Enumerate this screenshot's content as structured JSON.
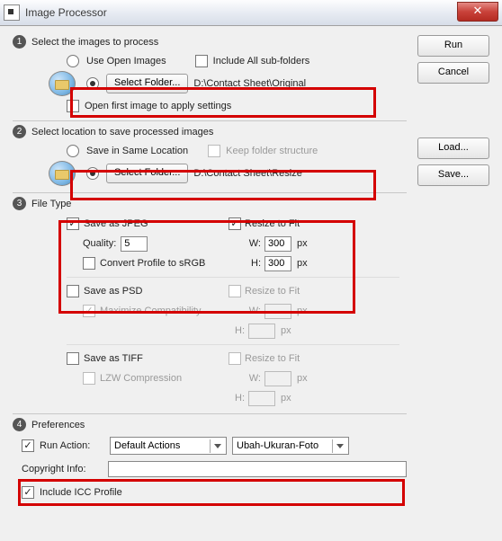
{
  "title": "Image Processor",
  "buttons": {
    "run": "Run",
    "cancel": "Cancel",
    "load": "Load...",
    "save": "Save..."
  },
  "section1": {
    "heading": "Select the images to process",
    "use_open": "Use Open Images",
    "include_sub": "Include All sub-folders",
    "select_folder": "Select Folder...",
    "path": "D:\\Contact Sheet\\Original",
    "open_first": "Open first image to apply settings"
  },
  "section2": {
    "heading": "Select location to save processed images",
    "save_same": "Save in Same Location",
    "keep_structure": "Keep folder structure",
    "select_folder": "Select Folder...",
    "path": "D:\\Contact Sheet\\Resize"
  },
  "section3": {
    "heading": "File Type",
    "jpeg": {
      "save": "Save as JPEG",
      "quality_label": "Quality:",
      "quality": "5",
      "convert": "Convert Profile to sRGB",
      "resize": "Resize to Fit",
      "w_label": "W:",
      "w": "300",
      "h_label": "H:",
      "h": "300",
      "px": "px"
    },
    "psd": {
      "save": "Save as PSD",
      "max_compat": "Maximize Compatibility",
      "resize": "Resize to Fit",
      "w_label": "W:",
      "h_label": "H:",
      "px": "px"
    },
    "tiff": {
      "save": "Save as TIFF",
      "lzw": "LZW Compression",
      "resize": "Resize to Fit",
      "w_label": "W:",
      "h_label": "H:",
      "px": "px"
    }
  },
  "section4": {
    "heading": "Preferences",
    "run_action": "Run Action:",
    "action_set": "Default Actions",
    "action_name": "Ubah-Ukuran-Foto",
    "copyright": "Copyright Info:",
    "include_icc": "Include ICC Profile"
  }
}
